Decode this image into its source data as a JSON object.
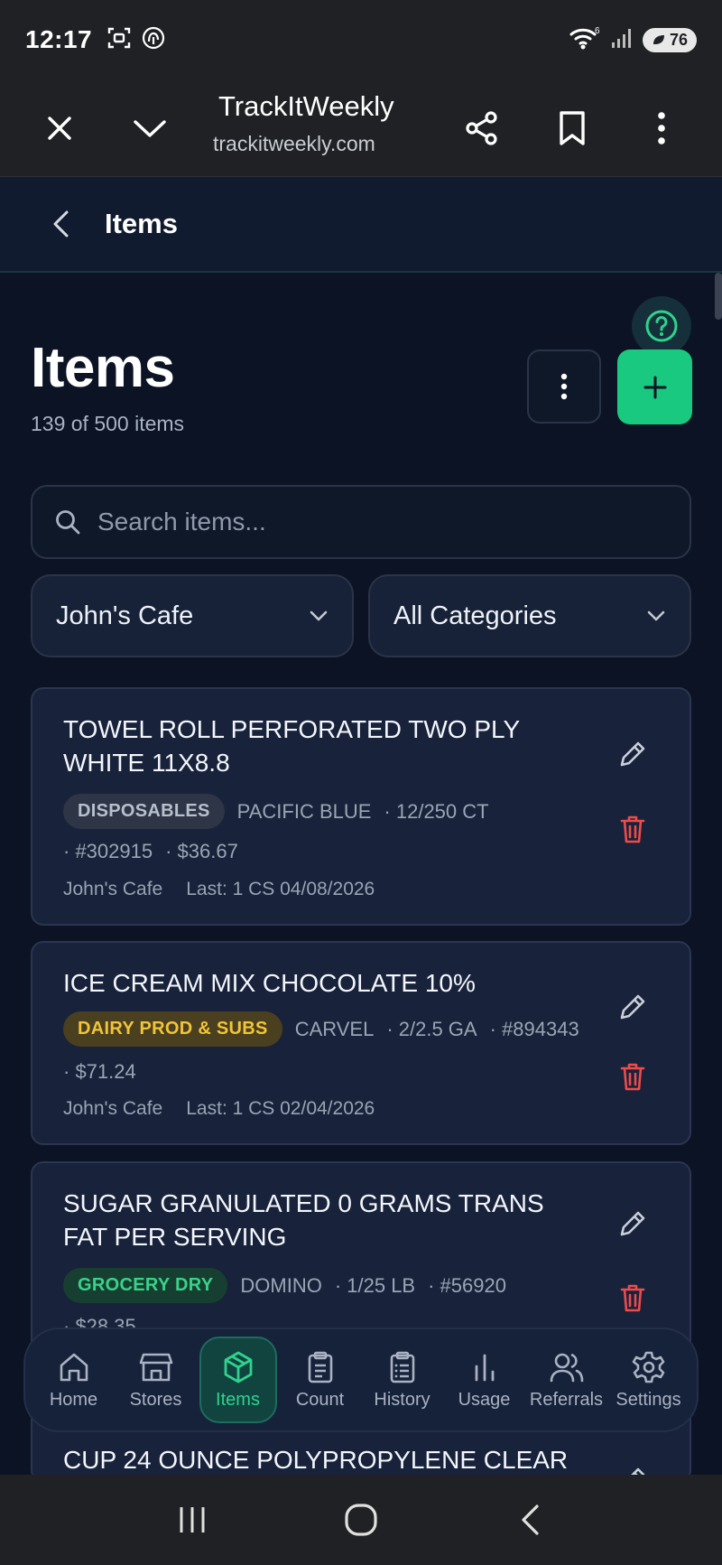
{
  "status_bar": {
    "time": "12:17",
    "battery": "76",
    "signal_label": "6"
  },
  "browser": {
    "title": "TrackItWeekly",
    "url": "trackitweekly.com"
  },
  "app_header": {
    "title": "Items"
  },
  "page": {
    "title": "Items",
    "count": "139 of 500 items"
  },
  "search": {
    "placeholder": "Search items..."
  },
  "filters": {
    "store": "John's Cafe",
    "category": "All Categories"
  },
  "items": [
    {
      "name": "TOWEL ROLL PERFORATED TWO PLY WHITE 11X8.8",
      "category": "DISPOSABLES",
      "brand": "PACIFIC BLUE",
      "pack": "· 12/250 CT",
      "number": "· #302915",
      "price": "· $36.67",
      "store": "John's Cafe",
      "last": "Last: 1 CS 04/08/2026"
    },
    {
      "name": "ICE CREAM MIX CHOCOLATE 10%",
      "category": "DAIRY PROD & SUBS",
      "brand": "CARVEL",
      "pack": "· 2/2.5 GA",
      "number": "· #894343",
      "price": "· $71.24",
      "store": "John's Cafe",
      "last": "Last: 1 CS 02/04/2026"
    },
    {
      "name": "SUGAR GRANULATED 0 GRAMS TRANS FAT PER SERVING",
      "category": "GROCERY DRY",
      "brand": "DOMINO",
      "pack": "· 1/25 LB",
      "number": "· #56920",
      "price": "· $28.35"
    },
    {
      "name": "CUP 24 OUNCE POLYPROPYLENE CLEAR"
    }
  ],
  "nav": [
    {
      "label": "Home",
      "icon": "home-icon"
    },
    {
      "label": "Stores",
      "icon": "store-icon"
    },
    {
      "label": "Items",
      "icon": "box-icon"
    },
    {
      "label": "Count",
      "icon": "clipboard-icon"
    },
    {
      "label": "History",
      "icon": "clipboard-list-icon"
    },
    {
      "label": "Usage",
      "icon": "bar-chart-icon"
    },
    {
      "label": "Referrals",
      "icon": "users-icon"
    },
    {
      "label": "Settings",
      "icon": "gear-icon"
    }
  ],
  "colors": {
    "accent": "#19c97f",
    "background": "#0c1324",
    "card": "#18223a",
    "delete": "#ef4b4b"
  }
}
